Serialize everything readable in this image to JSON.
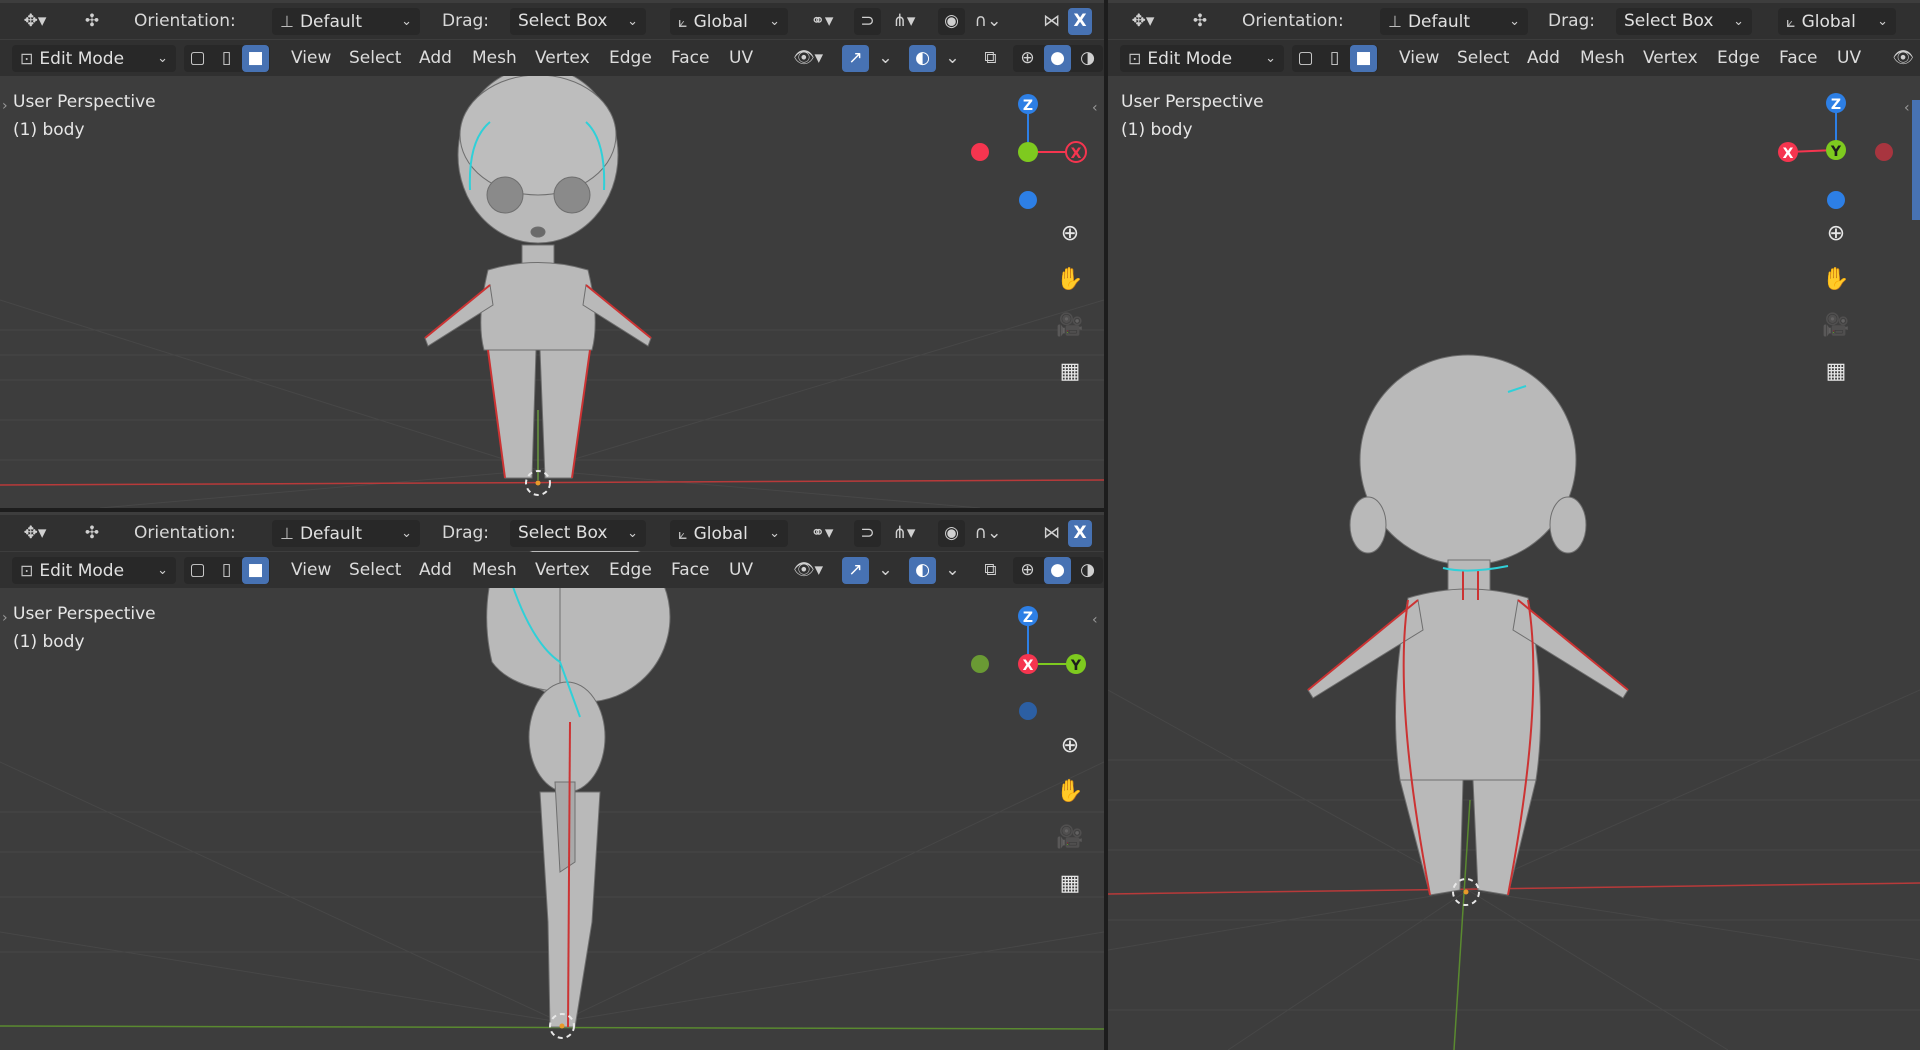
{
  "header": {
    "orientation_label": "Orientation:",
    "orientation_value": "Default",
    "drag_label": "Drag:",
    "drag_value": "Select Box",
    "transform_space": "Global",
    "axis_x": "X",
    "mode": "Edit Mode",
    "menus": [
      "View",
      "Select",
      "Add",
      "Mesh",
      "Vertex",
      "Edge",
      "Face",
      "UV"
    ]
  },
  "viewports": [
    {
      "view_label": "User Perspective",
      "object_label": "(1) body",
      "gizmo": [
        "Z",
        "X"
      ]
    },
    {
      "view_label": "User Perspective",
      "object_label": "(1) body",
      "gizmo": [
        "Z",
        "X",
        "Y"
      ]
    },
    {
      "view_label": "User Perspective",
      "object_label": "(1) body",
      "gizmo": [
        "Z",
        "X",
        "Y"
      ]
    }
  ],
  "icons": {
    "editor": "editor-type-icon",
    "move": "move-arrows-icon",
    "snap": "snap-magnet-icon",
    "proportional": "proportional-edit-icon",
    "visibility": "eye-icon",
    "gizmo": "gizmo-icon",
    "overlay": "overlay-icon",
    "xray": "xray-icon",
    "shading": [
      "wireframe-shading-icon",
      "solid-shading-icon",
      "material-shading-icon"
    ],
    "nav": [
      "zoom-icon",
      "hand-pan-icon",
      "camera-icon",
      "ortho-grid-icon"
    ]
  },
  "colors": {
    "accent_blue": "#4772b3",
    "axis_x": "#f5354f",
    "axis_y": "#7eca1f",
    "axis_z": "#2d7fe5",
    "viewport_bg": "#3d3d3d",
    "header_bg": "#303030"
  }
}
